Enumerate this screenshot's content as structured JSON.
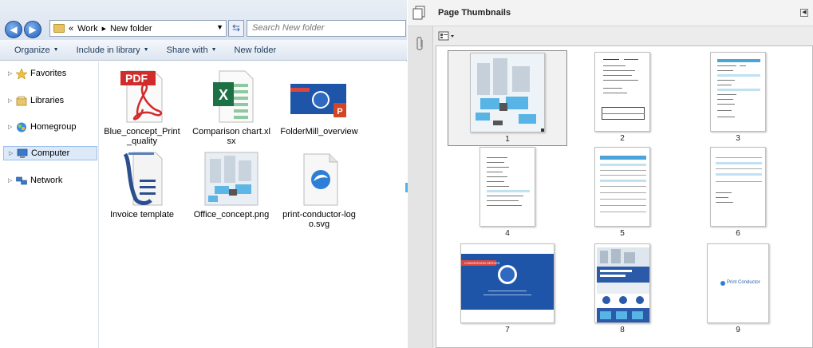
{
  "explorer": {
    "address": {
      "chevrons": "«",
      "crumbs": [
        "Work",
        "New folder"
      ]
    },
    "search_placeholder": "Search New folder",
    "toolbar": [
      {
        "label": "Organize",
        "has_menu": true
      },
      {
        "label": "Include in library",
        "has_menu": true
      },
      {
        "label": "Share with",
        "has_menu": true
      },
      {
        "label": "New folder",
        "has_menu": false
      }
    ],
    "nav": [
      {
        "label": "Favorites",
        "icon": "star-icon",
        "selected": false
      },
      {
        "label": "Libraries",
        "icon": "libraries-icon",
        "selected": false
      },
      {
        "label": "Homegroup",
        "icon": "homegroup-icon",
        "selected": false
      },
      {
        "label": "Computer",
        "icon": "computer-icon",
        "selected": true
      },
      {
        "label": "Network",
        "icon": "network-icon",
        "selected": false
      }
    ],
    "files": [
      {
        "name": "Blue_concept_Print_quality",
        "icon": "pdf-file-icon"
      },
      {
        "name": "Comparison chart.xlsx",
        "icon": "excel-file-icon"
      },
      {
        "name": "FolderMill_overview",
        "icon": "powerpoint-file-icon"
      },
      {
        "name": "Invoice template",
        "icon": "word-document-icon"
      },
      {
        "name": "Office_concept.png",
        "icon": "image-file-icon"
      },
      {
        "name": "print-conductor-logo.svg",
        "icon": "svg-file-icon"
      }
    ],
    "pdf_label": "PDF"
  },
  "reader": {
    "panel_title": "Page Thumbnails",
    "thumbnails": [
      "1",
      "2",
      "3",
      "4",
      "5",
      "6",
      "7",
      "8",
      "9"
    ],
    "page9_text": "Print Conductor",
    "page7_banner": "CONVERSION SERVER"
  },
  "colors": {
    "accent": "#4fb3ea",
    "ppt_blue": "#1f55a8",
    "pdf_red": "#d22b2b",
    "excel_green": "#1e7145"
  }
}
